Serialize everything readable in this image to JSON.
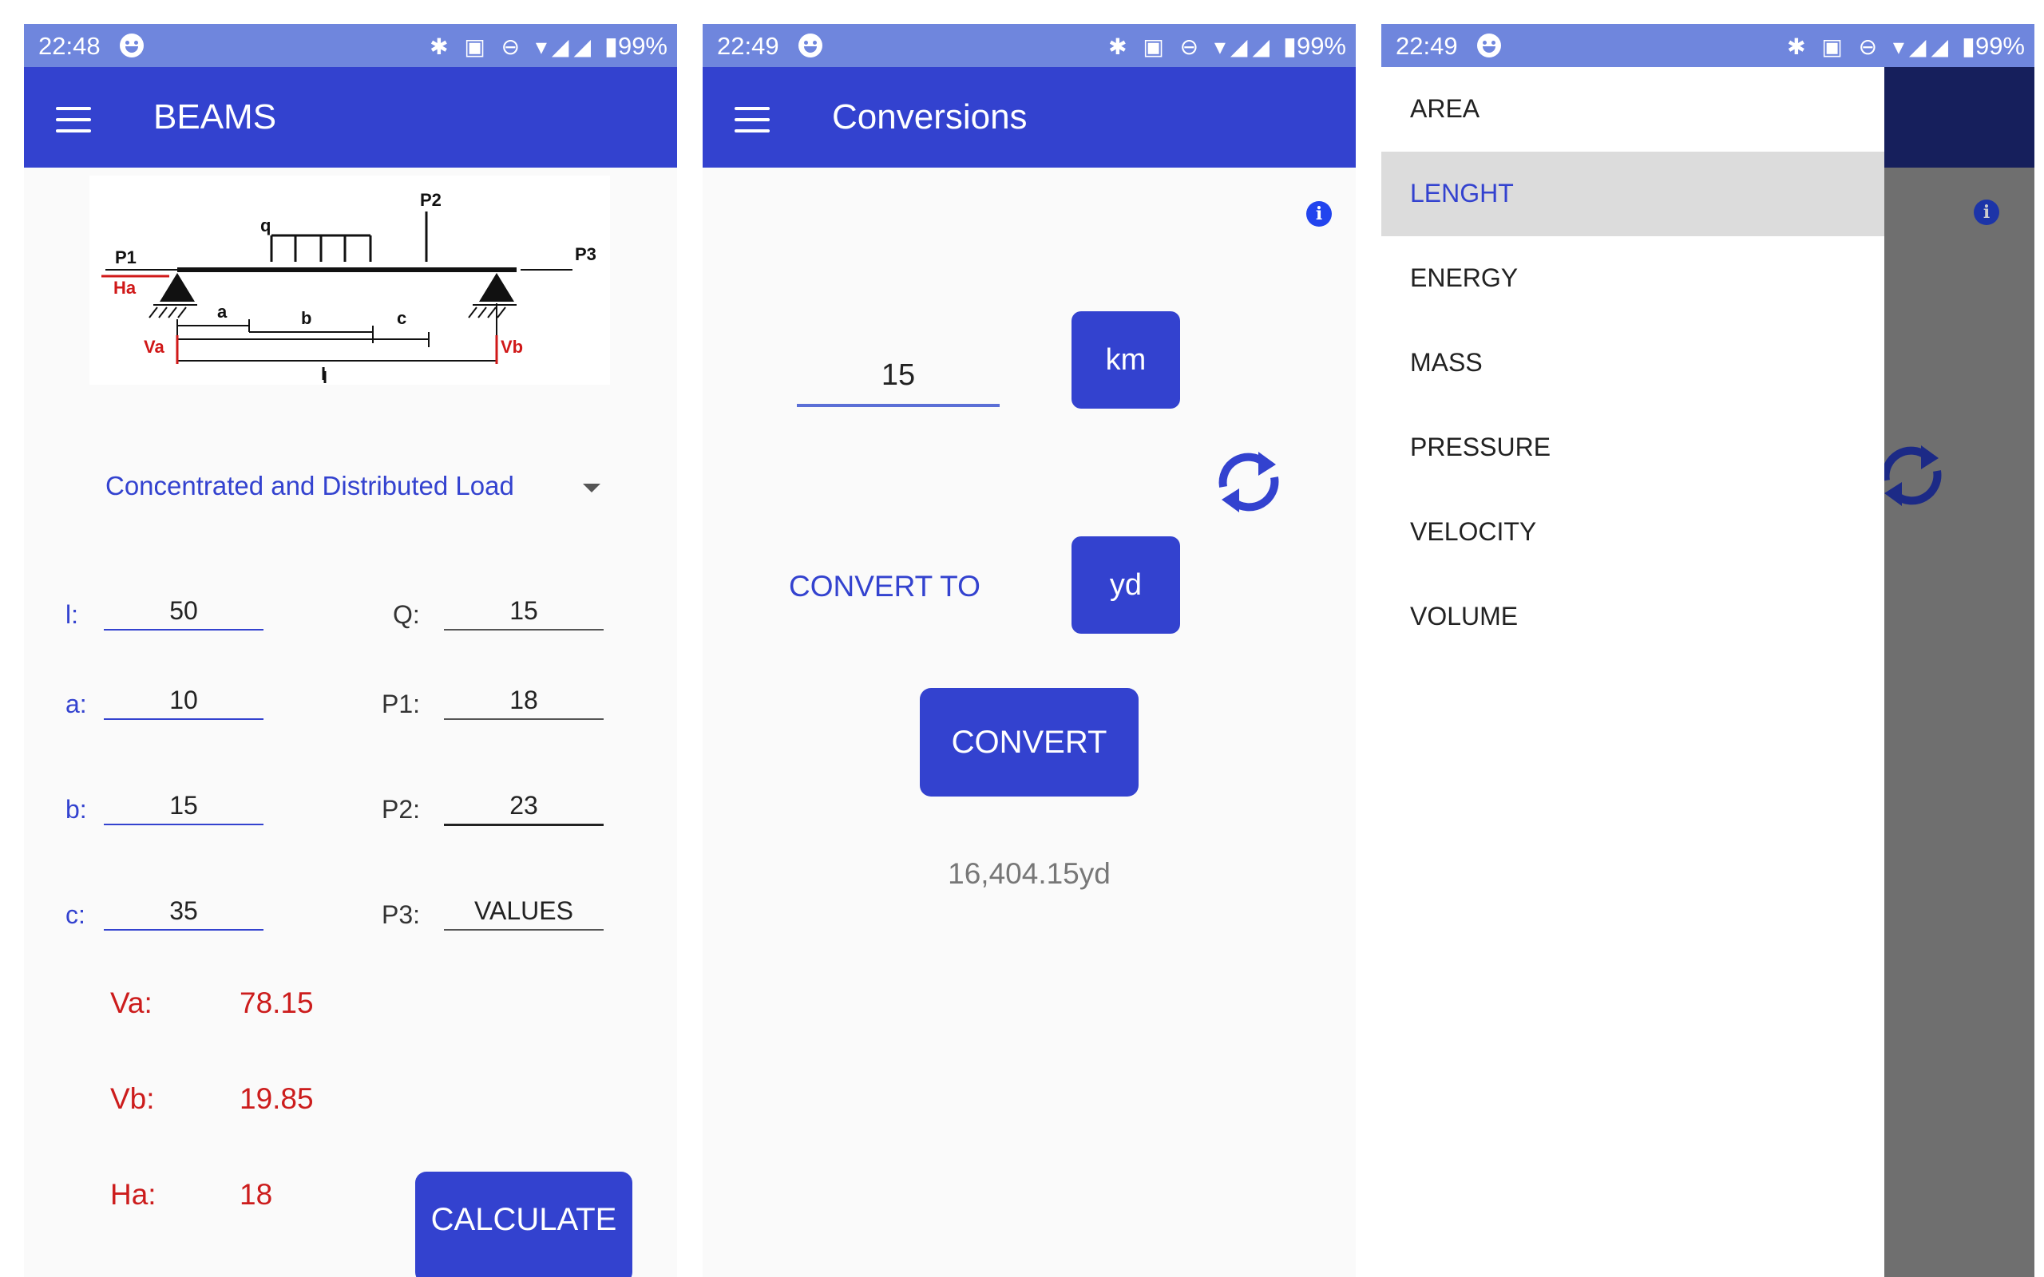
{
  "screens": {
    "beams": {
      "status": {
        "time": "22:48",
        "icons": "✱ ▣ ⊖ ▾◢◢",
        "battery": "▮99%"
      },
      "title": "BEAMS",
      "diagram_labels": {
        "p1": "P1",
        "p2": "P2",
        "p3": "P3",
        "q": "q",
        "ha": "Ha",
        "va": "Va",
        "vb": "Vb",
        "a": "a",
        "b": "b",
        "c": "c",
        "l": "l"
      },
      "load_type": "Concentrated and Distributed Load",
      "fields": {
        "l": {
          "label": "l:",
          "value": "50"
        },
        "a": {
          "label": "a:",
          "value": "10"
        },
        "b": {
          "label": "b:",
          "value": "15"
        },
        "c": {
          "label": "c:",
          "value": "35"
        },
        "q": {
          "label": "Q:",
          "value": "15"
        },
        "p1": {
          "label": "P1:",
          "value": "18"
        },
        "p2": {
          "label": "P2:",
          "value": "23"
        },
        "p3": {
          "label": "P3:",
          "value": "VALUES"
        }
      },
      "results": {
        "va": {
          "label": "Va:",
          "value": "78.15"
        },
        "vb": {
          "label": "Vb:",
          "value": "19.85"
        },
        "ha": {
          "label": "Ha:",
          "value": "18"
        }
      },
      "calculate_label": "CALCULATE"
    },
    "conversions": {
      "status": {
        "time": "22:49",
        "icons": "✱ ▣ ⊖ ▾◢◢",
        "battery": "▮99%"
      },
      "title": "Conversions",
      "info_icon": "i",
      "input_value": "15",
      "from_unit": "km",
      "convert_to_label": "CONVERT TO",
      "to_unit": "yd",
      "convert_label": "CONVERT",
      "result": "16,404.15yd"
    },
    "drawer": {
      "status": {
        "time": "22:49",
        "icons": "✱ ▣ ⊖ ▾◢◢",
        "battery": "▮99%"
      },
      "info_icon": "i",
      "items": [
        {
          "label": "AREA",
          "active": false
        },
        {
          "label": "LENGHT",
          "active": true
        },
        {
          "label": "ENERGY",
          "active": false
        },
        {
          "label": "MASS",
          "active": false
        },
        {
          "label": "PRESSURE",
          "active": false
        },
        {
          "label": "VELOCITY",
          "active": false
        },
        {
          "label": "VOLUME",
          "active": false
        }
      ]
    }
  },
  "colors": {
    "primary": "#3342cf",
    "status_bar": "#6f86dd",
    "result_red": "#cc1c1c",
    "active_item_bg": "#dcdcdc",
    "scrim": "#6f6f6f"
  }
}
